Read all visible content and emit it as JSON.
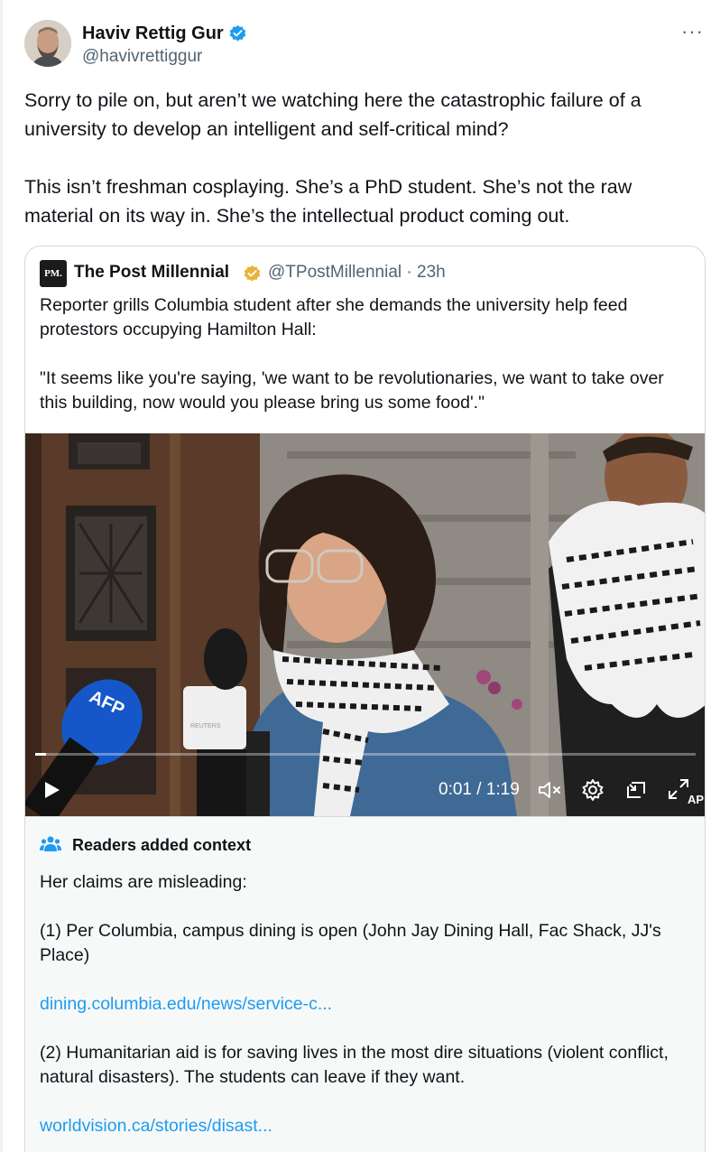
{
  "author": {
    "name": "Haviv Rettig Gur",
    "handle": "@havivrettiggur",
    "more_label": "···"
  },
  "tweet": {
    "paragraphs": [
      "Sorry to pile on, but aren’t we watching here the catastrophic failure of a university to develop an intelligent and self-critical mind?",
      "This isn’t freshman cosplaying. She’s a PhD student. She’s not the raw material on its way in. She’s the intellectual product coming out."
    ]
  },
  "quoted": {
    "logo_text": "PM.",
    "name": "The Post Millennial",
    "handle_time": "@TPostMillennial · 23h",
    "paragraphs": [
      "Reporter grills Columbia student after she demands the university help feed protestors occupying Hamilton Hall:",
      "\"It seems like you're saying, 'we want to be revolutionaries, we want to take over this building, now would you please bring us some food'.\""
    ]
  },
  "video": {
    "time": "0:01 / 1:19",
    "progress": 0.015,
    "mic_label": "AFP",
    "mic2_label": "REUTERS",
    "corner_label": "AP"
  },
  "notes": {
    "title": "Readers added context",
    "intro": "Her claims are misleading:",
    "point1": "(1) Per Columbia, campus dining is open (John Jay Dining Hall, Fac Shack, JJ's Place)",
    "link1": "dining.columbia.edu/news/service-c...",
    "point2": "(2) Humanitarian aid is for saving lives in the most dire situations (violent conflict, natural disasters). The students can leave if they want.",
    "link2": "worldvision.ca/stories/disast..."
  },
  "colors": {
    "verified_blue": "#1d9bf0",
    "gold_badge": "#e8b338",
    "link": "#1d9bf0",
    "muted": "#536471"
  },
  "icons": [
    "verified-icon",
    "gold-verified-icon",
    "more-icon",
    "play-icon",
    "mute-icon",
    "settings-icon",
    "pip-icon",
    "fullscreen-icon",
    "readers-icon"
  ]
}
